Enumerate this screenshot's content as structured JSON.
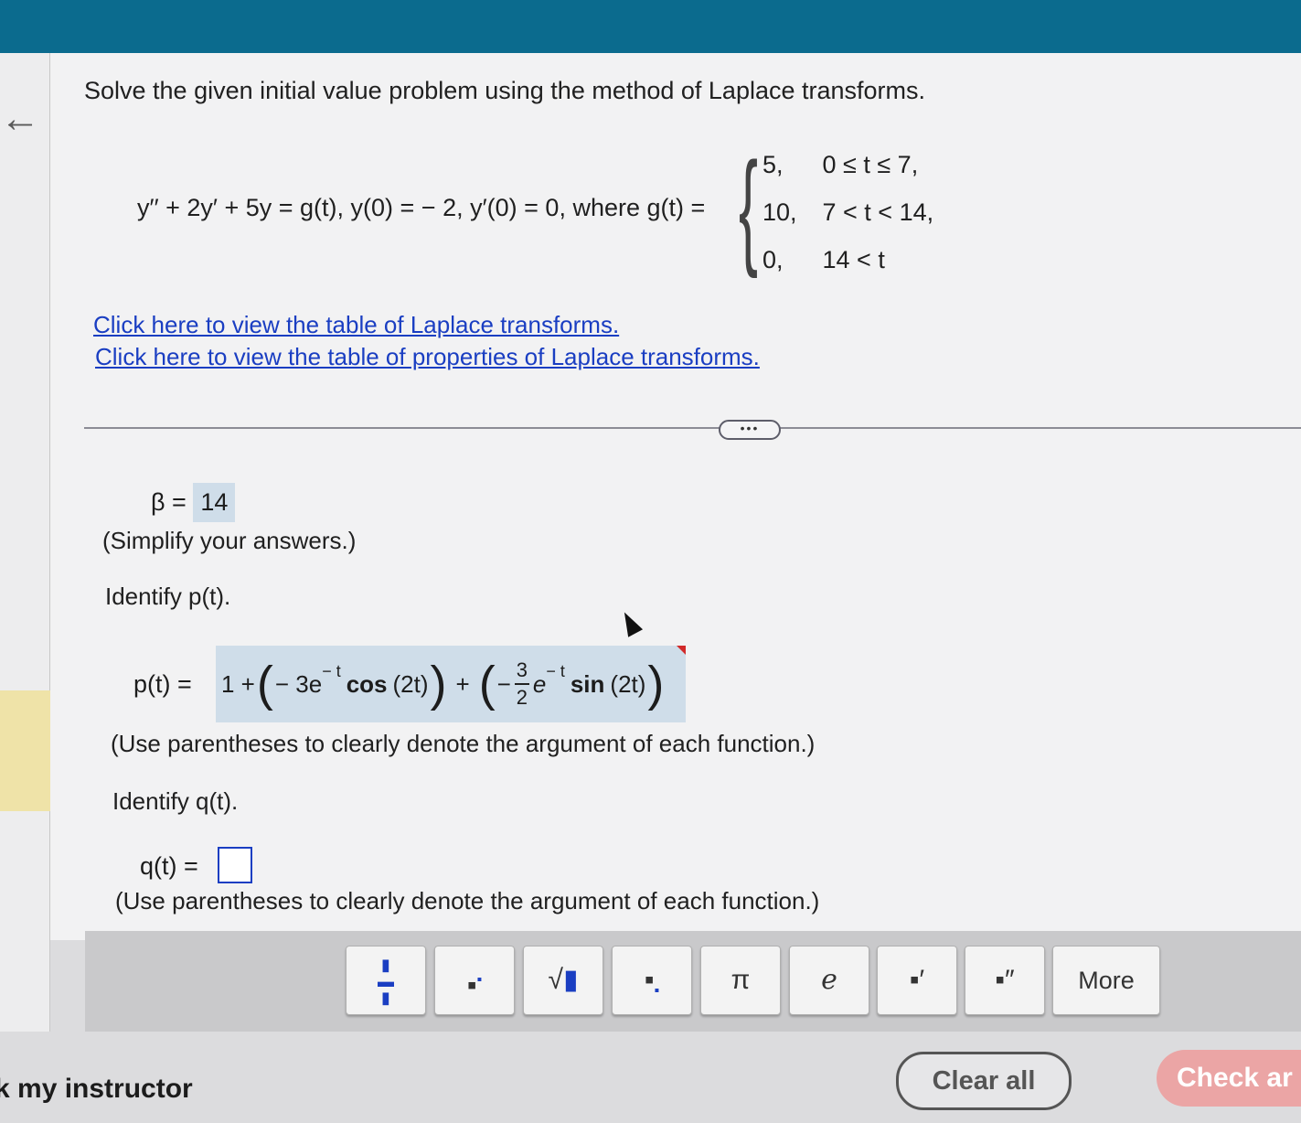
{
  "question": "Solve the given initial value problem using the method of Laplace transforms.",
  "equation": "y′′ + 2y′ + 5y = g(t), y(0) = − 2, y′(0) = 0, where g(t) =",
  "cases": [
    {
      "value": "5,",
      "condition": "0 ≤ t ≤ 7,"
    },
    {
      "value": "10,",
      "condition": "7 < t < 14,"
    },
    {
      "value": "0,",
      "condition": "14 < t"
    }
  ],
  "links": {
    "laplace_table": "Click here to view the table of Laplace transforms.",
    "properties_table": "Click here to view the table of properties of Laplace transforms."
  },
  "more_dots": "•••",
  "beta": {
    "label": "β  =",
    "value": "14"
  },
  "simplify_note": "(Simplify your answers.)",
  "identify_p": "Identify p(t).",
  "p": {
    "label": "p(t)  =",
    "term1": "1 +",
    "term2_prefix": "− 3e",
    "exp": "− t",
    "cos": "cos",
    "cos_arg": "(2t)",
    "plus": "+",
    "minus": "−",
    "frac_num": "3",
    "frac_den": "2",
    "e": "e",
    "sin": "sin",
    "sin_arg": "(2t)"
  },
  "paren_note": "(Use parentheses to clearly denote the argument of each function.)",
  "identify_q": "Identify q(t).",
  "q": {
    "label": "q(t)  =",
    "value": ""
  },
  "toolbar": {
    "buttons": [
      {
        "name": "fraction",
        "glyph": "▪/▪"
      },
      {
        "name": "superscript",
        "glyph": "▪'"
      },
      {
        "name": "sqrt",
        "glyph": "√▪"
      },
      {
        "name": "subscript",
        "glyph": "▪."
      },
      {
        "name": "pi",
        "glyph": "π"
      },
      {
        "name": "e",
        "glyph": "e"
      },
      {
        "name": "prime",
        "glyph": "▪′"
      },
      {
        "name": "double-prime",
        "glyph": "▪″"
      }
    ],
    "more": "More"
  },
  "footer": {
    "instructor": "k my instructor",
    "clear_all": "Clear all",
    "check_answer": "Check ar"
  },
  "colors": {
    "topbar": "#0b6b8e",
    "link": "#1a3ec2",
    "answer_bg": "#cfdde9",
    "check": "#eba5a5"
  }
}
